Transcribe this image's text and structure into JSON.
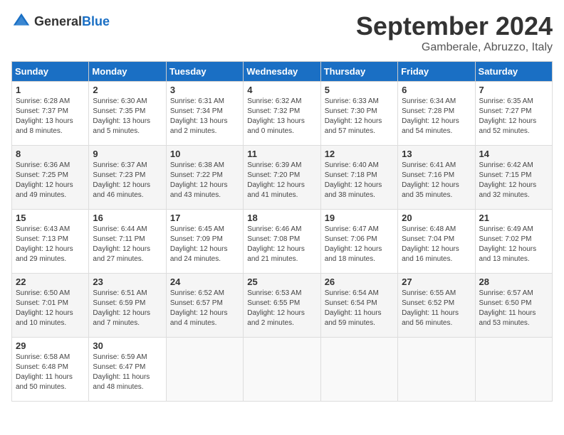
{
  "logo": {
    "general": "General",
    "blue": "Blue"
  },
  "title": "September 2024",
  "location": "Gamberale, Abruzzo, Italy",
  "days_of_week": [
    "Sunday",
    "Monday",
    "Tuesday",
    "Wednesday",
    "Thursday",
    "Friday",
    "Saturday"
  ],
  "weeks": [
    [
      {
        "num": "1",
        "sunrise": "6:28 AM",
        "sunset": "7:37 PM",
        "daylight": "13 hours and 8 minutes."
      },
      {
        "num": "2",
        "sunrise": "6:30 AM",
        "sunset": "7:35 PM",
        "daylight": "13 hours and 5 minutes."
      },
      {
        "num": "3",
        "sunrise": "6:31 AM",
        "sunset": "7:34 PM",
        "daylight": "13 hours and 2 minutes."
      },
      {
        "num": "4",
        "sunrise": "6:32 AM",
        "sunset": "7:32 PM",
        "daylight": "13 hours and 0 minutes."
      },
      {
        "num": "5",
        "sunrise": "6:33 AM",
        "sunset": "7:30 PM",
        "daylight": "12 hours and 57 minutes."
      },
      {
        "num": "6",
        "sunrise": "6:34 AM",
        "sunset": "7:28 PM",
        "daylight": "12 hours and 54 minutes."
      },
      {
        "num": "7",
        "sunrise": "6:35 AM",
        "sunset": "7:27 PM",
        "daylight": "12 hours and 52 minutes."
      }
    ],
    [
      {
        "num": "8",
        "sunrise": "6:36 AM",
        "sunset": "7:25 PM",
        "daylight": "12 hours and 49 minutes."
      },
      {
        "num": "9",
        "sunrise": "6:37 AM",
        "sunset": "7:23 PM",
        "daylight": "12 hours and 46 minutes."
      },
      {
        "num": "10",
        "sunrise": "6:38 AM",
        "sunset": "7:22 PM",
        "daylight": "12 hours and 43 minutes."
      },
      {
        "num": "11",
        "sunrise": "6:39 AM",
        "sunset": "7:20 PM",
        "daylight": "12 hours and 41 minutes."
      },
      {
        "num": "12",
        "sunrise": "6:40 AM",
        "sunset": "7:18 PM",
        "daylight": "12 hours and 38 minutes."
      },
      {
        "num": "13",
        "sunrise": "6:41 AM",
        "sunset": "7:16 PM",
        "daylight": "12 hours and 35 minutes."
      },
      {
        "num": "14",
        "sunrise": "6:42 AM",
        "sunset": "7:15 PM",
        "daylight": "12 hours and 32 minutes."
      }
    ],
    [
      {
        "num": "15",
        "sunrise": "6:43 AM",
        "sunset": "7:13 PM",
        "daylight": "12 hours and 29 minutes."
      },
      {
        "num": "16",
        "sunrise": "6:44 AM",
        "sunset": "7:11 PM",
        "daylight": "12 hours and 27 minutes."
      },
      {
        "num": "17",
        "sunrise": "6:45 AM",
        "sunset": "7:09 PM",
        "daylight": "12 hours and 24 minutes."
      },
      {
        "num": "18",
        "sunrise": "6:46 AM",
        "sunset": "7:08 PM",
        "daylight": "12 hours and 21 minutes."
      },
      {
        "num": "19",
        "sunrise": "6:47 AM",
        "sunset": "7:06 PM",
        "daylight": "12 hours and 18 minutes."
      },
      {
        "num": "20",
        "sunrise": "6:48 AM",
        "sunset": "7:04 PM",
        "daylight": "12 hours and 16 minutes."
      },
      {
        "num": "21",
        "sunrise": "6:49 AM",
        "sunset": "7:02 PM",
        "daylight": "12 hours and 13 minutes."
      }
    ],
    [
      {
        "num": "22",
        "sunrise": "6:50 AM",
        "sunset": "7:01 PM",
        "daylight": "12 hours and 10 minutes."
      },
      {
        "num": "23",
        "sunrise": "6:51 AM",
        "sunset": "6:59 PM",
        "daylight": "12 hours and 7 minutes."
      },
      {
        "num": "24",
        "sunrise": "6:52 AM",
        "sunset": "6:57 PM",
        "daylight": "12 hours and 4 minutes."
      },
      {
        "num": "25",
        "sunrise": "6:53 AM",
        "sunset": "6:55 PM",
        "daylight": "12 hours and 2 minutes."
      },
      {
        "num": "26",
        "sunrise": "6:54 AM",
        "sunset": "6:54 PM",
        "daylight": "11 hours and 59 minutes."
      },
      {
        "num": "27",
        "sunrise": "6:55 AM",
        "sunset": "6:52 PM",
        "daylight": "11 hours and 56 minutes."
      },
      {
        "num": "28",
        "sunrise": "6:57 AM",
        "sunset": "6:50 PM",
        "daylight": "11 hours and 53 minutes."
      }
    ],
    [
      {
        "num": "29",
        "sunrise": "6:58 AM",
        "sunset": "6:48 PM",
        "daylight": "11 hours and 50 minutes."
      },
      {
        "num": "30",
        "sunrise": "6:59 AM",
        "sunset": "6:47 PM",
        "daylight": "11 hours and 48 minutes."
      },
      null,
      null,
      null,
      null,
      null
    ]
  ],
  "label_sunrise": "Sunrise:",
  "label_sunset": "Sunset:",
  "label_daylight": "Daylight:"
}
